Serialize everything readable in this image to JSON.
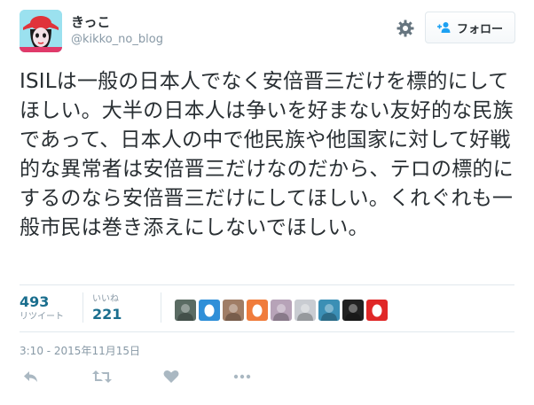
{
  "user": {
    "display_name": "きっこ",
    "handle": "@kikko_no_blog"
  },
  "follow": {
    "label": "フォロー"
  },
  "tweet": {
    "text": "ISILは一般の日本人でなく安倍晋三だけを標的にしてほしい。大半の日本人は争いを好まない友好的な民族であって、日本人の中で他民族や他国家に対して好戦的な異常者は安倍晋三だけなのだから、テロの標的にするのなら安倍晋三だけにしてほしい。くれぐれも一般市民は巻き添えにしないでほしい。"
  },
  "stats": {
    "retweets": {
      "value": "493",
      "label": "リツイート"
    },
    "likes": {
      "value": "221",
      "label": "いいね"
    }
  },
  "likers": [
    {
      "icon": "avatar-photo-icon",
      "color": "#5a6b63"
    },
    {
      "icon": "egg-icon",
      "color": "#2f8fd8"
    },
    {
      "icon": "avatar-photo-icon",
      "color": "#a07d66"
    },
    {
      "icon": "egg-icon",
      "color": "#f07c3c"
    },
    {
      "icon": "avatar-photo-icon",
      "color": "#b7a3b8"
    },
    {
      "icon": "avatar-photo-icon",
      "color": "#c9ccd2"
    },
    {
      "icon": "avatar-photo-icon",
      "color": "#3b8fb5"
    },
    {
      "icon": "avatar-photo-icon",
      "color": "#222222"
    },
    {
      "icon": "egg-icon",
      "color": "#e02828"
    }
  ],
  "timestamp": "3:10 - 2015年11月15日",
  "colors": {
    "accent": "#1a6e8e",
    "muted": "#8899a6",
    "border": "#e1e8ed"
  }
}
